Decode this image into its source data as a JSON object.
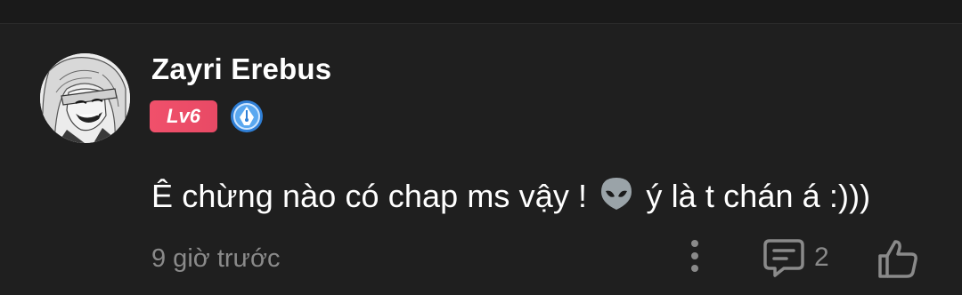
{
  "comment": {
    "username": "Zayri Erebus",
    "level": "Lv6",
    "text_before_emoji": "Ê chừng nào có chap ms vậy ! ",
    "emoji": "alien-emoji",
    "text_after_emoji": " ý là t chán á :)))",
    "timestamp": "9 giờ trước",
    "reply_count": "2"
  },
  "colors": {
    "background": "#1f1f1f",
    "level_badge": "#f0506b",
    "rank_icon": "#3a8fe0",
    "muted_text": "#8a8a8a"
  },
  "icons": {
    "more": "more-vertical-icon",
    "reply": "comment-icon",
    "like": "thumbs-up-icon",
    "rank": "pen-nib-rank-icon"
  }
}
